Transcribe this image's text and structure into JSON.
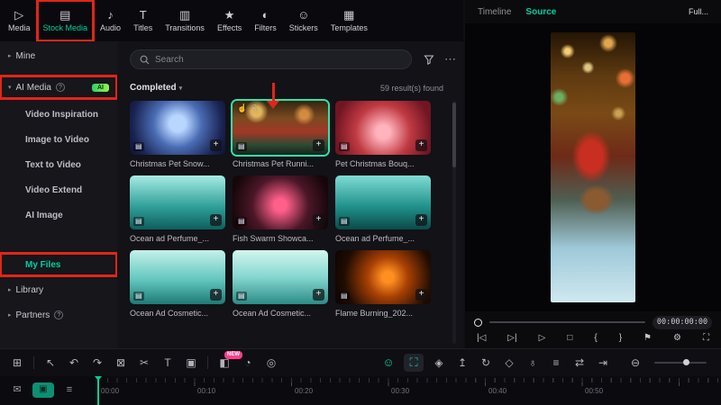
{
  "colors": {
    "accent_teal": "#00cf9f",
    "annotation_red": "#e1251b",
    "ai_badge_green": "#2ed164",
    "new_badge_pink": "#ff3d8a"
  },
  "top_tabs": {
    "items": [
      {
        "label": "Media",
        "glyph": "▷"
      },
      {
        "label": "Stock Media",
        "glyph": "▤",
        "active": true
      },
      {
        "label": "Audio",
        "glyph": "♪"
      },
      {
        "label": "Titles",
        "glyph": "T"
      },
      {
        "label": "Transitions",
        "glyph": "▥"
      },
      {
        "label": "Effects",
        "glyph": "★"
      },
      {
        "label": "Filters",
        "glyph": "◐"
      },
      {
        "label": "Stickers",
        "glyph": "☺"
      },
      {
        "label": "Templates",
        "glyph": "▦"
      }
    ]
  },
  "sidebar": {
    "items": [
      {
        "label": "Mine",
        "caret": "▸"
      },
      {
        "label": "AI Media",
        "caret": "▾",
        "help": "?",
        "badge": "AI"
      },
      {
        "label": "Video Inspiration"
      },
      {
        "label": "Image to Video"
      },
      {
        "label": "Text to Video"
      },
      {
        "label": "Video Extend"
      },
      {
        "label": "AI Image"
      },
      {
        "label": "My Files",
        "active": true
      },
      {
        "label": "Library",
        "caret": "▸"
      },
      {
        "label": "Partners",
        "caret": "▸",
        "help": "?"
      }
    ]
  },
  "search": {
    "placeholder": "Search",
    "more_glyph": "⋯"
  },
  "results_bar": {
    "status_filter": "Completed",
    "caret": "▾",
    "count_text": "59 result(s) found"
  },
  "grid": {
    "type_glyph": "▤",
    "add_glyph": "+",
    "like_glyph": "☝",
    "dislike_glyph": "☟",
    "items": [
      {
        "title": "Christmas Pet Snow..."
      },
      {
        "title": "Christmas Pet Runni...",
        "selected": true
      },
      {
        "title": "Pet Christmas Bouq..."
      },
      {
        "title": "Ocean ad Perfume_..."
      },
      {
        "title": "Fish Swarm Showca..."
      },
      {
        "title": "Ocean ad Perfume_..."
      },
      {
        "title": "Ocean Ad Cosmetic..."
      },
      {
        "title": "Ocean Ad Cosmetic..."
      },
      {
        "title": "Flame Burning_202..."
      }
    ]
  },
  "preview": {
    "tab_timeline": "Timeline",
    "tab_source": "Source",
    "full_label": "Full...",
    "timecode": "00:00:00:00",
    "transport": [
      {
        "name": "previous-frame",
        "glyph": "|◁"
      },
      {
        "name": "next-frame",
        "glyph": "▷|"
      },
      {
        "name": "play",
        "glyph": "▷"
      },
      {
        "name": "stop",
        "glyph": "□"
      },
      {
        "name": "mark-in",
        "glyph": "{"
      },
      {
        "name": "mark-out",
        "glyph": "}"
      },
      {
        "name": "marker",
        "glyph": "⚑"
      },
      {
        "name": "settings",
        "glyph": "⚙"
      },
      {
        "name": "fullscreen",
        "glyph": "⛶"
      }
    ]
  },
  "toolbar": {
    "left": [
      {
        "name": "apps-grid",
        "glyph": "⊞"
      },
      {
        "name": "select-tool",
        "glyph": "↖"
      },
      {
        "name": "undo",
        "glyph": "↶"
      },
      {
        "name": "redo",
        "glyph": "↷"
      },
      {
        "name": "delete",
        "glyph": "⊠"
      },
      {
        "name": "split",
        "glyph": "✂"
      },
      {
        "name": "text",
        "glyph": "T"
      },
      {
        "name": "crop",
        "glyph": "▣"
      },
      {
        "name": "mask",
        "glyph": "◧",
        "badge": "NEW"
      },
      {
        "name": "speed",
        "glyph": "◔"
      },
      {
        "name": "record",
        "glyph": "◎"
      }
    ],
    "center": [
      {
        "name": "ai-portrait",
        "glyph": "☺",
        "teal": true
      },
      {
        "name": "auto-reframe",
        "glyph": "⛶",
        "teal": true,
        "selected": true
      },
      {
        "name": "effects-library",
        "glyph": "◈"
      },
      {
        "name": "export-clip",
        "glyph": "↥"
      },
      {
        "name": "render",
        "glyph": "↻"
      },
      {
        "name": "shield",
        "glyph": "◇"
      },
      {
        "name": "microphone",
        "glyph": "♁"
      },
      {
        "name": "mixer",
        "glyph": "≡"
      },
      {
        "name": "transition-swap",
        "glyph": "⇄"
      },
      {
        "name": "snap",
        "glyph": "⇥"
      }
    ],
    "zoom_out_glyph": "⊖"
  },
  "timeline_strip": {
    "buttons": [
      {
        "name": "comment",
        "glyph": "✉"
      },
      {
        "name": "ai-copilot",
        "glyph": "▣"
      },
      {
        "name": "track-manager",
        "glyph": "≡"
      }
    ],
    "ruler_labels": [
      "00:00",
      "00:10",
      "00:20",
      "00:30",
      "00:40",
      "00:50"
    ]
  },
  "annotations": {
    "boxed_elements": [
      "Stock Media",
      "AI Media",
      "My Files"
    ],
    "arrow_target": "Christmas Pet Runni... grid item"
  }
}
